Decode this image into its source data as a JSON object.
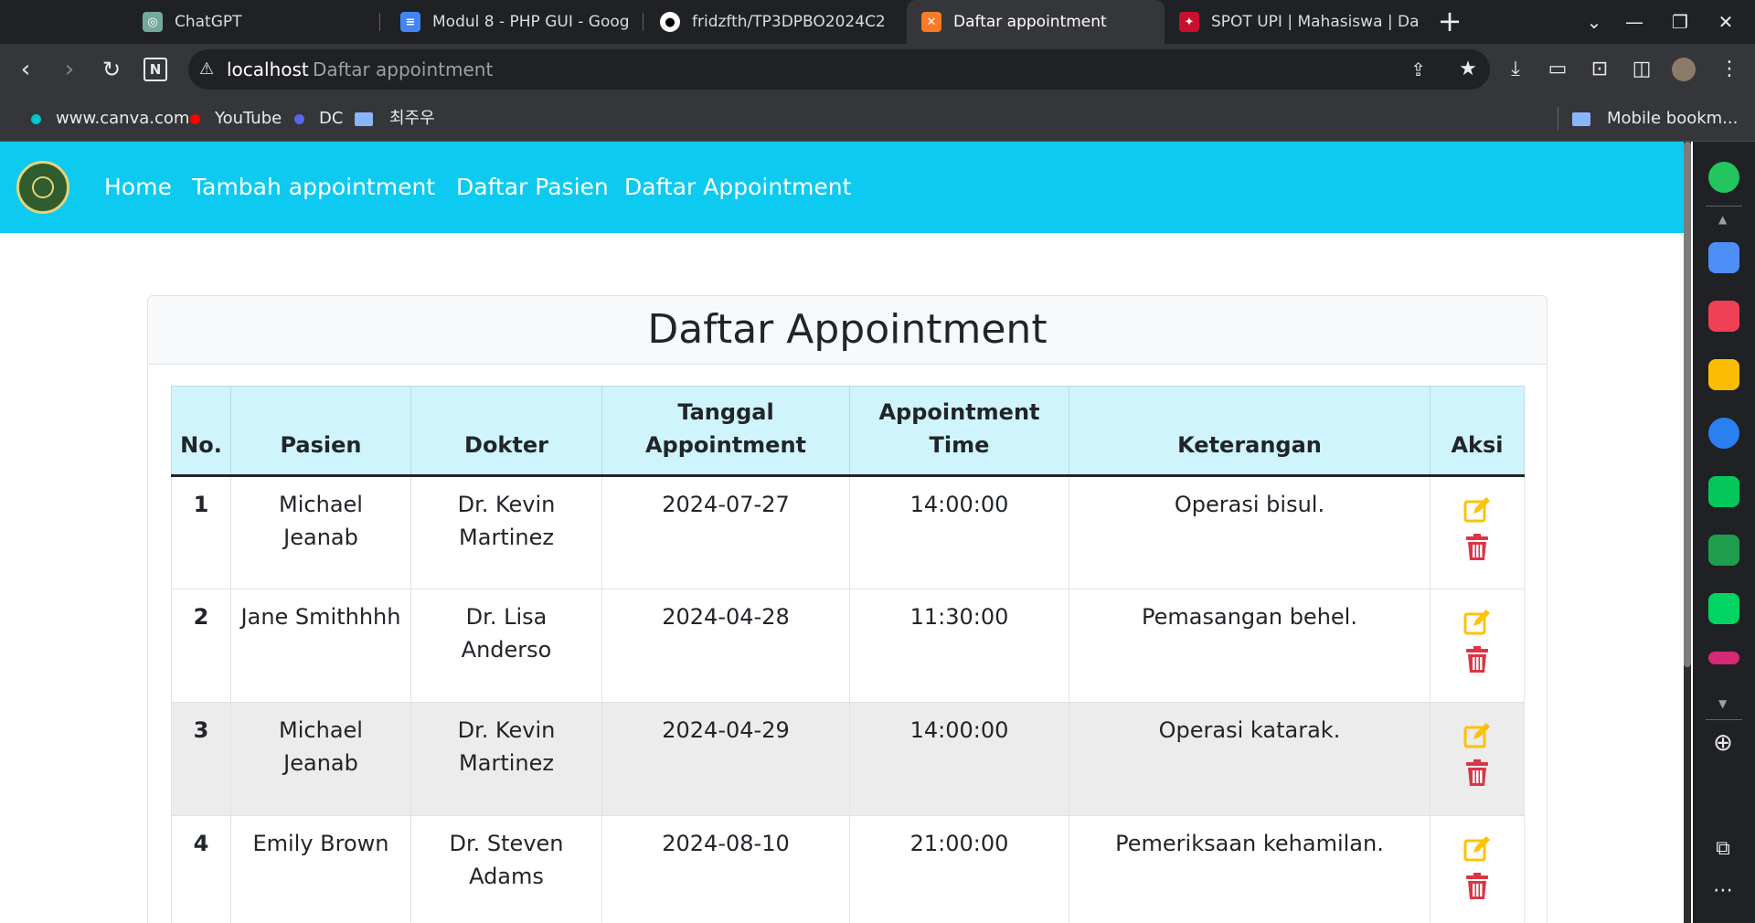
{
  "browser": {
    "tabs": [
      {
        "title": "ChatGPT",
        "icon": "chatgpt-icon"
      },
      {
        "title": "Modul 8 - PHP GUI - Goog",
        "icon": "google-docs-icon"
      },
      {
        "title": "fridzfth/TP3DPBO2024C2",
        "icon": "github-icon"
      },
      {
        "title": "Daftar appointment",
        "icon": "xampp-icon",
        "active": true
      },
      {
        "title": "SPOT UPI | Mahasiswa | Da",
        "icon": "upi-icon"
      }
    ],
    "address": {
      "host": "localhost",
      "title": "Daftar appointment"
    },
    "bookmarks": [
      {
        "label": "www.canva.com",
        "color": "#00c4cc"
      },
      {
        "label": "YouTube",
        "color": "#ff0000"
      },
      {
        "label": "DC",
        "color": "#5865f2"
      },
      {
        "label": "최주우",
        "color": "#8ab4f8"
      }
    ],
    "bookmarks_right": "Mobile bookm..."
  },
  "navbar": {
    "color": "#0dcaf0",
    "links": [
      "Home",
      "Tambah appointment",
      "Daftar Pasien",
      "Daftar Appointment"
    ]
  },
  "page": {
    "title": "Daftar Appointment",
    "table": {
      "headers": [
        "No.",
        "Pasien",
        "Dokter",
        "Tanggal Appointment",
        "Appointment Time",
        "Keterangan",
        "Aksi"
      ],
      "rows": [
        {
          "no": "1",
          "pasien": "Michael Jeanab",
          "dokter": "Dr. Kevin Martinez",
          "tanggal": "2024-07-27",
          "time": "14:00:00",
          "keterangan": "Operasi bisul."
        },
        {
          "no": "2",
          "pasien": "Jane Smithhhh",
          "dokter": "Dr. Lisa Anderso",
          "tanggal": "2024-04-28",
          "time": "11:30:00",
          "keterangan": "Pemasangan behel."
        },
        {
          "no": "3",
          "pasien": "Michael Jeanab",
          "dokter": "Dr. Kevin Martinez",
          "tanggal": "2024-04-29",
          "time": "14:00:00",
          "keterangan": "Operasi katarak."
        },
        {
          "no": "4",
          "pasien": "Emily Brown",
          "dokter": "Dr. Steven Adams",
          "tanggal": "2024-08-10",
          "time": "21:00:00",
          "keterangan": "Pemeriksaan kehamilan."
        }
      ]
    },
    "edit_color": "#ffc107",
    "delete_color": "#dc3545"
  }
}
